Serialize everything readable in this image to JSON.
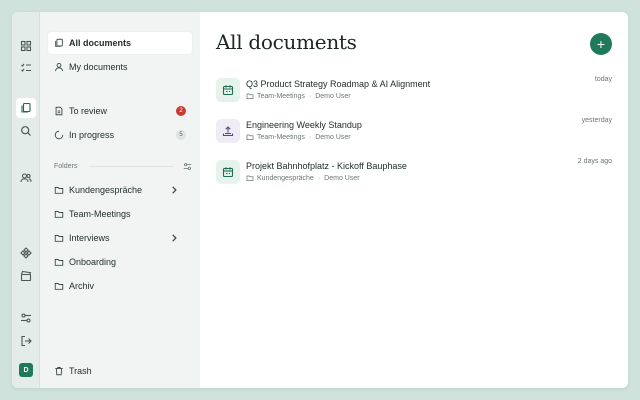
{
  "sidebar": {
    "nav": [
      {
        "label": "All documents",
        "icon": "copy-icon"
      },
      {
        "label": "My documents",
        "icon": "user-icon"
      },
      {
        "label": "To review",
        "icon": "file-icon",
        "badge": "2"
      },
      {
        "label": "In progress",
        "icon": "spinner-icon",
        "badge": "5"
      }
    ],
    "folders_label": "Folders",
    "folders": [
      {
        "label": "Kundengespräche",
        "has_children": true
      },
      {
        "label": "Team-Meetings",
        "has_children": false
      },
      {
        "label": "Interviews",
        "has_children": true
      },
      {
        "label": "Onboarding",
        "has_children": false
      },
      {
        "label": "Archiv",
        "has_children": false
      }
    ],
    "trash_label": "Trash"
  },
  "rail": {
    "avatar_initial": "D"
  },
  "main": {
    "title": "All documents",
    "add_label": "+",
    "documents": [
      {
        "title": "Q3 Product Strategy Roadmap & AI Alignment",
        "folder": "Team-Meetings",
        "owner": "Demo User",
        "time": "today",
        "icon": "calendar-icon"
      },
      {
        "title": "Engineering Weekly Standup",
        "folder": "Team-Meetings",
        "owner": "Demo User",
        "time": "yesterday",
        "icon": "upload-icon"
      },
      {
        "title": "Projekt Bahnhofplatz - Kickoff Bauphase",
        "folder": "Kundengespräche",
        "owner": "Demo User",
        "time": "2 days ago",
        "icon": "calendar-icon"
      }
    ]
  },
  "colors": {
    "accent": "#1f7a5c",
    "badge_red": "#c83a32",
    "background": "#cfe3dc"
  }
}
